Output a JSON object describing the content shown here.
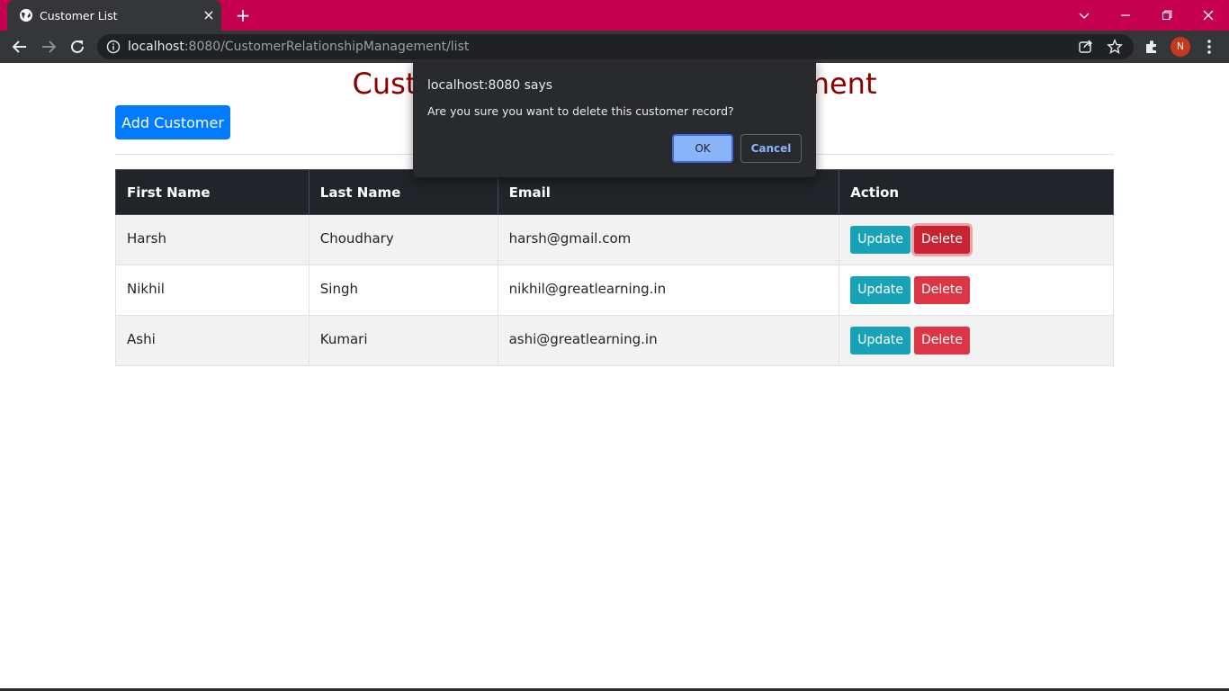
{
  "browser": {
    "tab_title": "Customer List",
    "tab_close": "×",
    "new_tab": "+",
    "url_host": "localhost",
    "url_rest": ":8080/CustomerRelationshipManagement/list",
    "profile_initial": "N",
    "tabbar_color": "#c4004f"
  },
  "page": {
    "title": "Customer Relationship Management",
    "add_button": "Add Customer",
    "table": {
      "headers": [
        "First Name",
        "Last Name",
        "Email",
        "Action"
      ],
      "rows": [
        {
          "first": "Harsh",
          "last": "Choudhary",
          "email": "harsh@gmail.com",
          "update": "Update",
          "delete": "Delete"
        },
        {
          "first": "Nikhil",
          "last": "Singh",
          "email": "nikhil@greatlearning.in",
          "update": "Update",
          "delete": "Delete"
        },
        {
          "first": "Ashi",
          "last": "Kumari",
          "email": "ashi@greatlearning.in",
          "update": "Update",
          "delete": "Delete"
        }
      ]
    }
  },
  "dialog": {
    "title": "localhost:8080 says",
    "message": "Are you sure you want to delete this customer record?",
    "ok": "OK",
    "cancel": "Cancel"
  }
}
